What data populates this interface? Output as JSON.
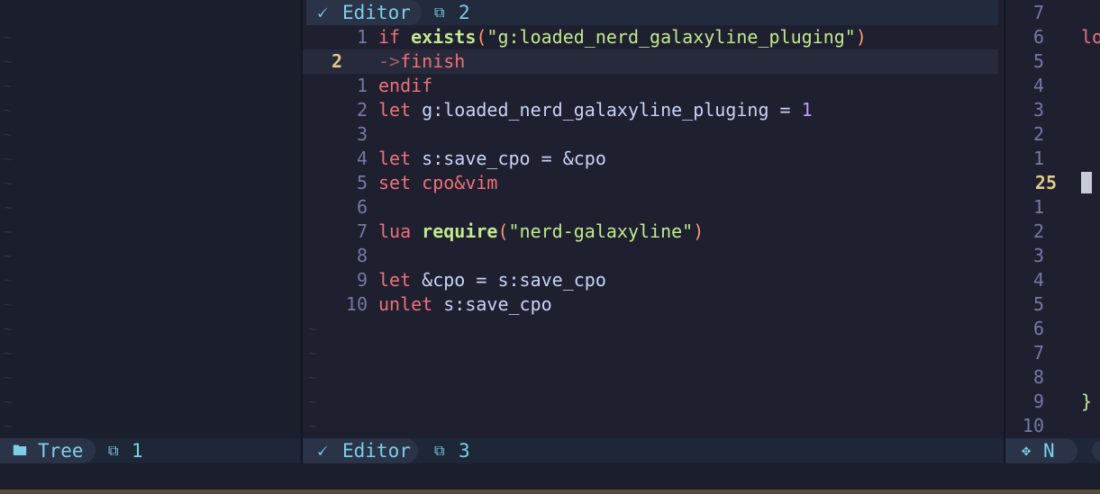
{
  "tabline": {
    "icon": "🗸",
    "label": "Editor",
    "window_icon": "⧉",
    "window_num": "2"
  },
  "editor": {
    "lines": [
      {
        "num": "1",
        "current": false,
        "tokens": [
          {
            "t": "if ",
            "c": "kw"
          },
          {
            "t": "exists",
            "c": "fn"
          },
          {
            "t": "(",
            "c": "paren"
          },
          {
            "t": "\"g:loaded_nerd_galaxyline_pluging\"",
            "c": "str"
          },
          {
            "t": ")",
            "c": "paren"
          }
        ]
      },
      {
        "num": "2",
        "current": true,
        "tokens": [
          {
            "t": "->",
            "c": "arrow"
          },
          {
            "t": "finish",
            "c": "kw"
          }
        ]
      },
      {
        "num": "1",
        "current": false,
        "tokens": [
          {
            "t": "endif",
            "c": "kw"
          }
        ]
      },
      {
        "num": "2",
        "current": false,
        "tokens": [
          {
            "t": "let ",
            "c": "kw"
          },
          {
            "t": "g:loaded_nerd_galaxyline_pluging = ",
            "c": "txt"
          },
          {
            "t": "1",
            "c": "num"
          }
        ]
      },
      {
        "num": "3",
        "current": false,
        "tokens": []
      },
      {
        "num": "4",
        "current": false,
        "tokens": [
          {
            "t": "let ",
            "c": "kw"
          },
          {
            "t": "s:save_cpo = ",
            "c": "txt"
          },
          {
            "t": "&cpo",
            "c": "txt"
          }
        ]
      },
      {
        "num": "5",
        "current": false,
        "tokens": [
          {
            "t": "set ",
            "c": "kw"
          },
          {
            "t": "cpo&vim",
            "c": "kw"
          }
        ]
      },
      {
        "num": "6",
        "current": false,
        "tokens": []
      },
      {
        "num": "7",
        "current": false,
        "tokens": [
          {
            "t": "lua ",
            "c": "kw"
          },
          {
            "t": "require",
            "c": "fn"
          },
          {
            "t": "(",
            "c": "paren"
          },
          {
            "t": "\"nerd-galaxyline\"",
            "c": "str"
          },
          {
            "t": ")",
            "c": "paren"
          }
        ]
      },
      {
        "num": "8",
        "current": false,
        "tokens": []
      },
      {
        "num": "9",
        "current": false,
        "tokens": [
          {
            "t": "let ",
            "c": "kw"
          },
          {
            "t": "&cpo = s:save_cpo",
            "c": "txt"
          }
        ]
      },
      {
        "num": "10",
        "current": false,
        "tokens": [
          {
            "t": "unlet ",
            "c": "kw"
          },
          {
            "t": "s:save_cpo",
            "c": "txt"
          }
        ]
      }
    ],
    "tilde": "~"
  },
  "right_pane": {
    "line_numbers": [
      "7",
      "6",
      "5",
      "4",
      "3",
      "2",
      "1",
      "25",
      "1",
      "2",
      "3",
      "4",
      "5",
      "6",
      "7",
      "8",
      "9",
      "10"
    ],
    "current_index": 7,
    "snippets": [
      {
        "row": 1,
        "text": "lo",
        "c": "kw"
      },
      {
        "row": 16,
        "text": "}",
        "c": "str"
      }
    ]
  },
  "status": {
    "left": {
      "icon": "🖿",
      "label": "Tree",
      "window_icon": "⧉",
      "window_num": "1"
    },
    "mid": {
      "icon": "🗸",
      "label": "Editor",
      "window_icon": "⧉",
      "window_num": "3"
    },
    "right": {
      "icon": "✥",
      "label": "N"
    }
  }
}
